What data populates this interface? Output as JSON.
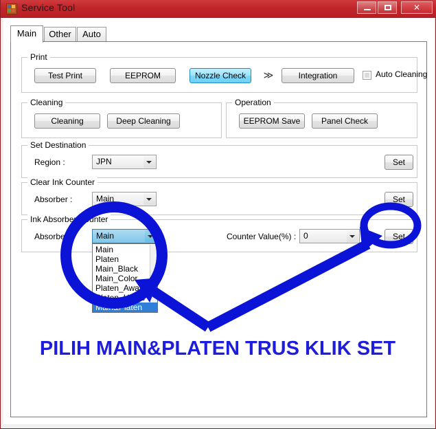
{
  "window": {
    "title": "Service Tool",
    "icon": "app-icon",
    "controls": {
      "minimize": "minimize",
      "maximize": "maximize",
      "close": "✕"
    },
    "accent_color": "#c2262b"
  },
  "tabs": [
    {
      "label": "Main",
      "active": true
    },
    {
      "label": "Other",
      "active": false
    },
    {
      "label": "Auto",
      "active": false
    }
  ],
  "groups": {
    "print": {
      "legend": "Print",
      "buttons": [
        {
          "label": "Test Print",
          "state": "normal"
        },
        {
          "label": "EEPROM",
          "state": "normal"
        },
        {
          "label": "Nozzle Check",
          "state": "hover"
        },
        {
          "label": "Integration",
          "state": "normal"
        }
      ],
      "separator": "≫",
      "checkbox": {
        "label": "Auto Cleaning",
        "checked": false
      }
    },
    "cleaning": {
      "legend": "Cleaning",
      "buttons": [
        {
          "label": "Cleaning"
        },
        {
          "label": "Deep Cleaning"
        }
      ]
    },
    "operation": {
      "legend": "Operation",
      "buttons": [
        {
          "label": "EEPROM Save"
        },
        {
          "label": "Panel Check"
        }
      ]
    },
    "set_destination": {
      "legend": "Set Destination",
      "field_label": "Region :",
      "value": "JPN",
      "set_label": "Set"
    },
    "clear_ink_counter": {
      "legend": "Clear Ink Counter",
      "field_label": "Absorber :",
      "value": "Main",
      "set_label": "Set"
    },
    "ink_absorber_counter": {
      "legend": "Ink Absorber Counter",
      "field_label": "Absorber :",
      "value": "Main",
      "options": [
        "Main",
        "Platen",
        "Main_Black",
        "Main_Color",
        "Platen_Away",
        "Platen_Home",
        "Main&Platen"
      ],
      "selected_option": "Main&Platen",
      "counter_label": "Counter Value(%) :",
      "counter_value": "0",
      "set_label": "Set"
    }
  },
  "annotation": {
    "text": "PILIH MAIN&PLATEN TRUS KLIK SET",
    "color": "#1d1ddb",
    "circle_dropdown": "circle-highlight-dropdown",
    "circle_set": "circle-highlight-set-button",
    "arrow_dropdown": "arrow-to-dropdown",
    "arrow_set": "arrow-to-set-button"
  }
}
